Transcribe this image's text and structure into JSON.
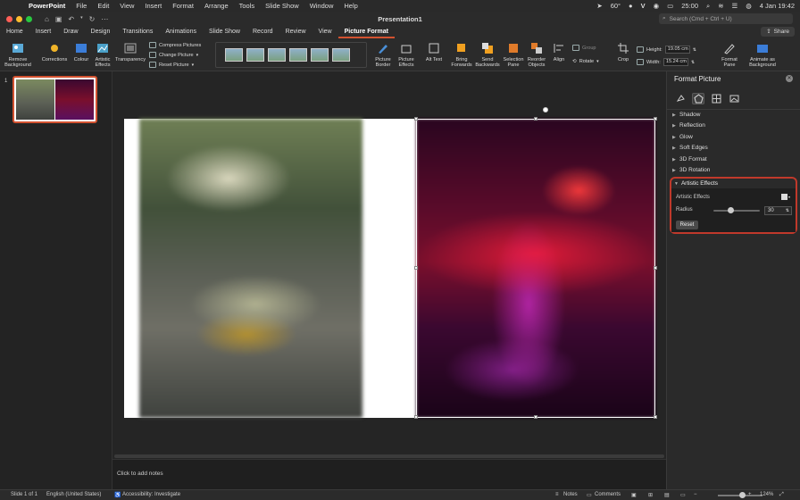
{
  "menubar": {
    "app_name": "PowerPoint",
    "items": [
      "File",
      "Edit",
      "View",
      "Insert",
      "Format",
      "Arrange",
      "Tools",
      "Slide Show",
      "Window",
      "Help"
    ],
    "temperature": "60°",
    "letter": "V",
    "battery_time": "25:00",
    "datetime": "4 Jan  19:42"
  },
  "titlebar": {
    "document_title": "Presentation1",
    "search_placeholder": "Search (Cmd + Ctrl + U)"
  },
  "tabs": [
    "Home",
    "Insert",
    "Draw",
    "Design",
    "Transitions",
    "Animations",
    "Slide Show",
    "Record",
    "Review",
    "View",
    "Picture Format"
  ],
  "active_tab": "Picture Format",
  "share_label": "Share",
  "ribbon": {
    "remove_background": "Remove Background",
    "corrections": "Corrections",
    "colour": "Colour",
    "artistic_effects": "Artistic Effects",
    "transparency": "Transparency",
    "compress_pictures": "Compress Pictures",
    "change_picture": "Change Picture",
    "reset_picture": "Reset Picture",
    "picture_border": "Picture Border",
    "picture_effects": "Picture Effects",
    "alt_text": "Alt Text",
    "bring_forwards": "Bring Forwards",
    "send_backwards": "Send Backwards",
    "selection_pane": "Selection Pane",
    "reorder_objects": "Reorder Objects",
    "align": "Align",
    "group": "Group",
    "rotate": "Rotate",
    "crop": "Crop",
    "height_label": "Height:",
    "height_value": "19.05 cm",
    "width_label": "Width:",
    "width_value": "15.24 cm",
    "format_pane": "Format Pane",
    "animate_as_background": "Animate as Background"
  },
  "slide_panel": {
    "slide_number": "1"
  },
  "notes_placeholder": "Click to add notes",
  "format_pane": {
    "title": "Format Picture",
    "sections": [
      "Shadow",
      "Reflection",
      "Glow",
      "Soft Edges",
      "3D Format",
      "3D Rotation"
    ],
    "artistic_effects": {
      "header": "Artistic Effects",
      "effects_label": "Artistic Effects",
      "radius_label": "Radius",
      "radius_value": "30",
      "radius_fraction": 0.3,
      "reset_label": "Reset"
    }
  },
  "status": {
    "slide_info": "Slide 1 of 1",
    "language": "English (United States)",
    "accessibility": "Accessibility: Investigate",
    "notes": "Notes",
    "comments": "Comments",
    "zoom": "124%"
  },
  "colors": {
    "accent": "#d35230",
    "highlight": "#c0392b"
  }
}
